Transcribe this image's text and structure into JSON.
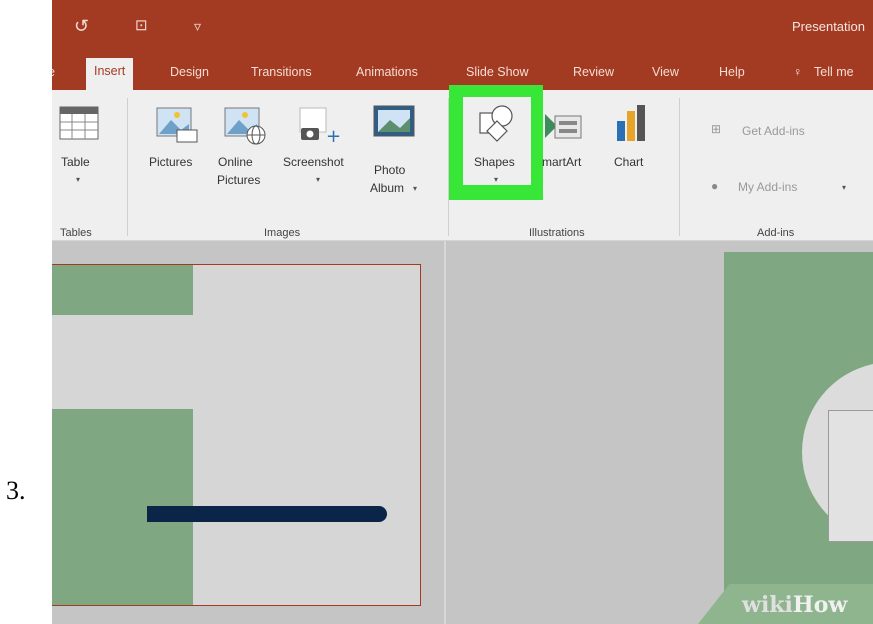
{
  "step": {
    "number": "3."
  },
  "window": {
    "title": "Presentation"
  },
  "quick_access": [
    {
      "name": "redo-icon",
      "glyph": "↺"
    },
    {
      "name": "start-from-beginning-icon",
      "glyph": "⊡"
    },
    {
      "name": "customize-toolbar-icon",
      "glyph": "▿"
    }
  ],
  "tabs": [
    {
      "label": "e"
    },
    {
      "label": "Insert",
      "active": true
    },
    {
      "label": "Design"
    },
    {
      "label": "Transitions"
    },
    {
      "label": "Animations"
    },
    {
      "label": "Slide Show"
    },
    {
      "label": "Review"
    },
    {
      "label": "View"
    },
    {
      "label": "Help"
    },
    {
      "label": "Tell me"
    }
  ],
  "ribbon": {
    "table": {
      "label": "Table"
    },
    "pictures": {
      "label": "Pictures"
    },
    "online_pictures": {
      "line1": "Online",
      "line2": "Pictures"
    },
    "screenshot": {
      "label": "Screenshot"
    },
    "photo_album": {
      "line1": "Photo",
      "line2": "Album"
    },
    "shapes": {
      "label": "Shapes"
    },
    "smartart": {
      "label": "martArt"
    },
    "chart": {
      "label": "Chart"
    },
    "get_addins": {
      "label": "Get Add-ins"
    },
    "my_addins": {
      "label": "My Add-ins"
    },
    "groups": {
      "tables": "Tables",
      "images": "Images",
      "illustrations": "Illustrations",
      "addins": "Add-ins"
    }
  },
  "highlight_color": "#38e637",
  "accent_color": "#a33b23",
  "watermark": {
    "part1": "wiki",
    "part2": "How"
  }
}
